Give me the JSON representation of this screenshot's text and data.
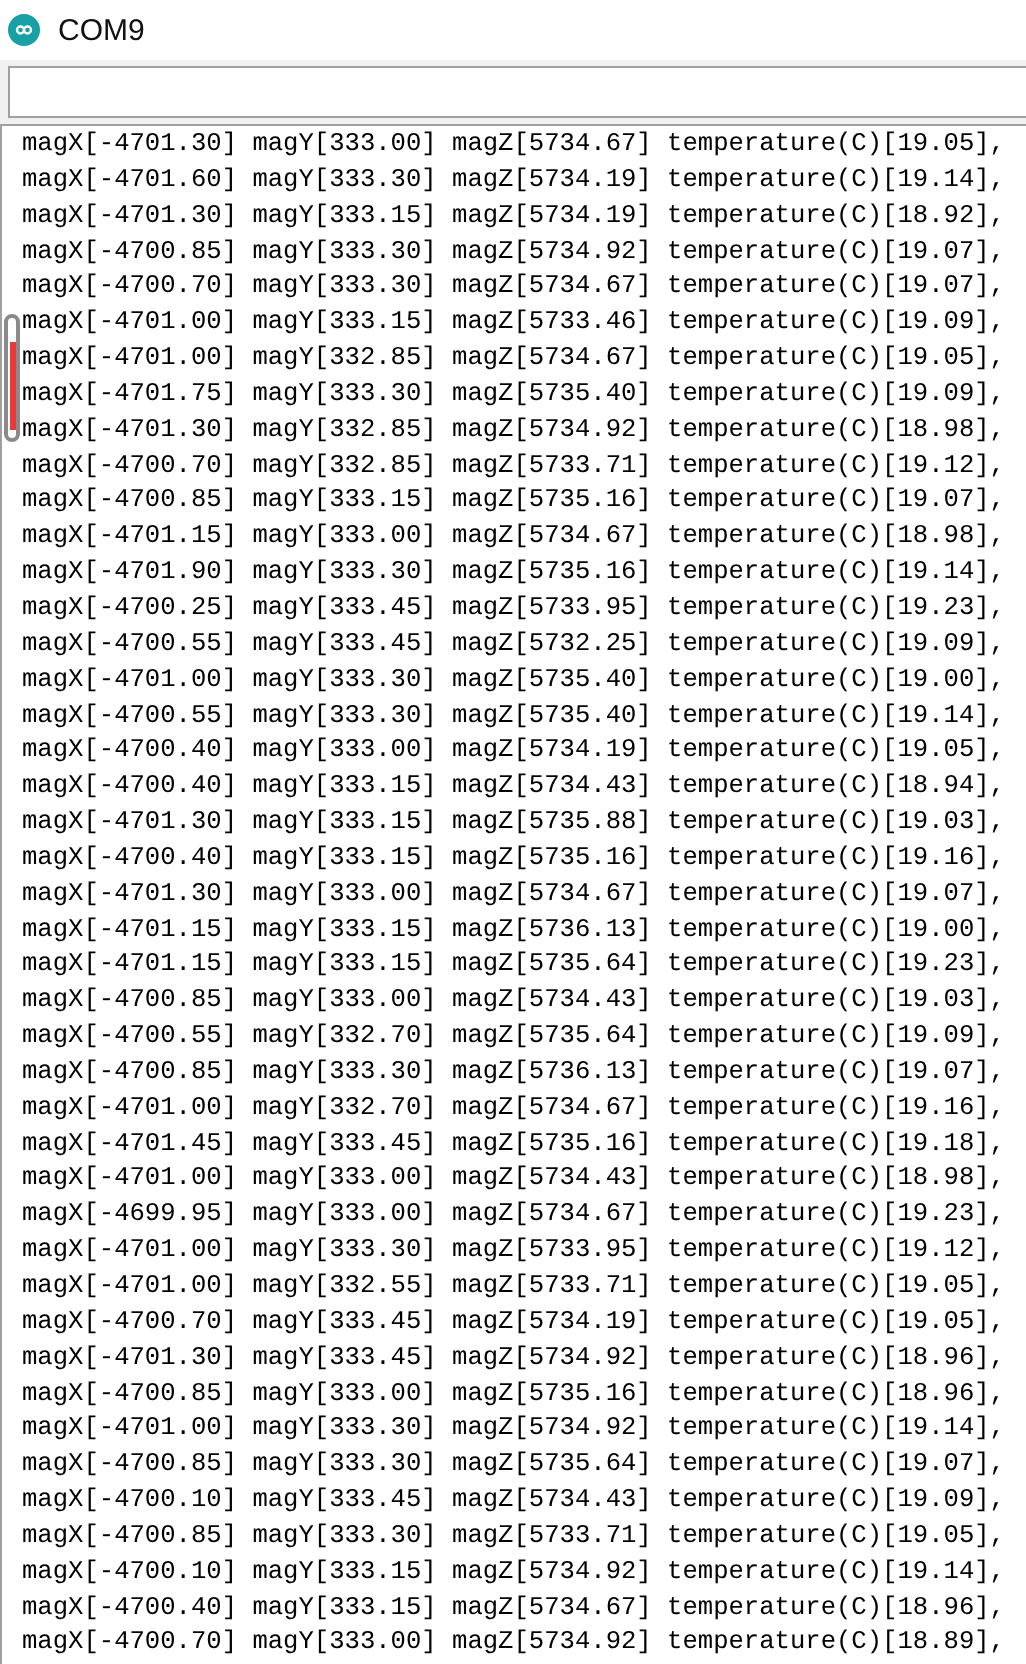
{
  "window": {
    "title": "COM9"
  },
  "output_lines": [
    "magX[-4701.30] magY[333.00] magZ[5734.67] temperature(C)[19.05],",
    "magX[-4701.60] magY[333.30] magZ[5734.19] temperature(C)[19.14],",
    "magX[-4701.30] magY[333.15] magZ[5734.19] temperature(C)[18.92],",
    "magX[-4700.85] magY[333.30] magZ[5734.92] temperature(C)[19.07],",
    "magX[-4700.70] magY[333.30] magZ[5734.67] temperature(C)[19.07],",
    "magX[-4701.00] magY[333.15] magZ[5733.46] temperature(C)[19.09],",
    "magX[-4701.00] magY[332.85] magZ[5734.67] temperature(C)[19.05],",
    "magX[-4701.75] magY[333.30] magZ[5735.40] temperature(C)[19.09],",
    "magX[-4701.30] magY[332.85] magZ[5734.92] temperature(C)[18.98],",
    "magX[-4700.70] magY[332.85] magZ[5733.71] temperature(C)[19.12],",
    "magX[-4700.85] magY[333.15] magZ[5735.16] temperature(C)[19.07],",
    "magX[-4701.15] magY[333.00] magZ[5734.67] temperature(C)[18.98],",
    "magX[-4701.90] magY[333.30] magZ[5735.16] temperature(C)[19.14],",
    "magX[-4700.25] magY[333.45] magZ[5733.95] temperature(C)[19.23],",
    "magX[-4700.55] magY[333.45] magZ[5732.25] temperature(C)[19.09],",
    "magX[-4701.00] magY[333.30] magZ[5735.40] temperature(C)[19.00],",
    "magX[-4700.55] magY[333.30] magZ[5735.40] temperature(C)[19.14],",
    "magX[-4700.40] magY[333.00] magZ[5734.19] temperature(C)[19.05],",
    "magX[-4700.40] magY[333.15] magZ[5734.43] temperature(C)[18.94],",
    "magX[-4701.30] magY[333.15] magZ[5735.88] temperature(C)[19.03],",
    "magX[-4700.40] magY[333.15] magZ[5735.16] temperature(C)[19.16],",
    "magX[-4701.30] magY[333.00] magZ[5734.67] temperature(C)[19.07],",
    "magX[-4701.15] magY[333.15] magZ[5736.13] temperature(C)[19.00],",
    "magX[-4701.15] magY[333.15] magZ[5735.64] temperature(C)[19.23],",
    "magX[-4700.85] magY[333.00] magZ[5734.43] temperature(C)[19.03],",
    "magX[-4700.55] magY[332.70] magZ[5735.64] temperature(C)[19.09],",
    "magX[-4700.85] magY[333.30] magZ[5736.13] temperature(C)[19.07],",
    "magX[-4701.00] magY[332.70] magZ[5734.67] temperature(C)[19.16],",
    "magX[-4701.45] magY[333.45] magZ[5735.16] temperature(C)[19.18],",
    "magX[-4701.00] magY[333.00] magZ[5734.43] temperature(C)[18.98],",
    "magX[-4699.95] magY[333.00] magZ[5734.67] temperature(C)[19.23],",
    "magX[-4701.00] magY[333.30] magZ[5733.95] temperature(C)[19.12],",
    "magX[-4701.00] magY[332.55] magZ[5733.71] temperature(C)[19.05],",
    "magX[-4700.70] magY[333.45] magZ[5734.19] temperature(C)[19.05],",
    "magX[-4701.30] magY[333.45] magZ[5734.92] temperature(C)[18.96],",
    "magX[-4700.85] magY[333.00] magZ[5735.16] temperature(C)[18.96],",
    "magX[-4701.00] magY[333.30] magZ[5734.92] temperature(C)[19.14],",
    "magX[-4700.85] magY[333.30] magZ[5735.64] temperature(C)[19.07],",
    "magX[-4700.10] magY[333.45] magZ[5734.43] temperature(C)[19.09],",
    "magX[-4700.85] magY[333.30] magZ[5733.71] temperature(C)[19.05],",
    "magX[-4700.10] magY[333.15] magZ[5734.92] temperature(C)[19.14],",
    "magX[-4700.40] magY[333.15] magZ[5734.67] temperature(C)[18.96],",
    "magX[-4700.70] magY[333.00] magZ[5734.92] temperature(C)[18.89],"
  ]
}
